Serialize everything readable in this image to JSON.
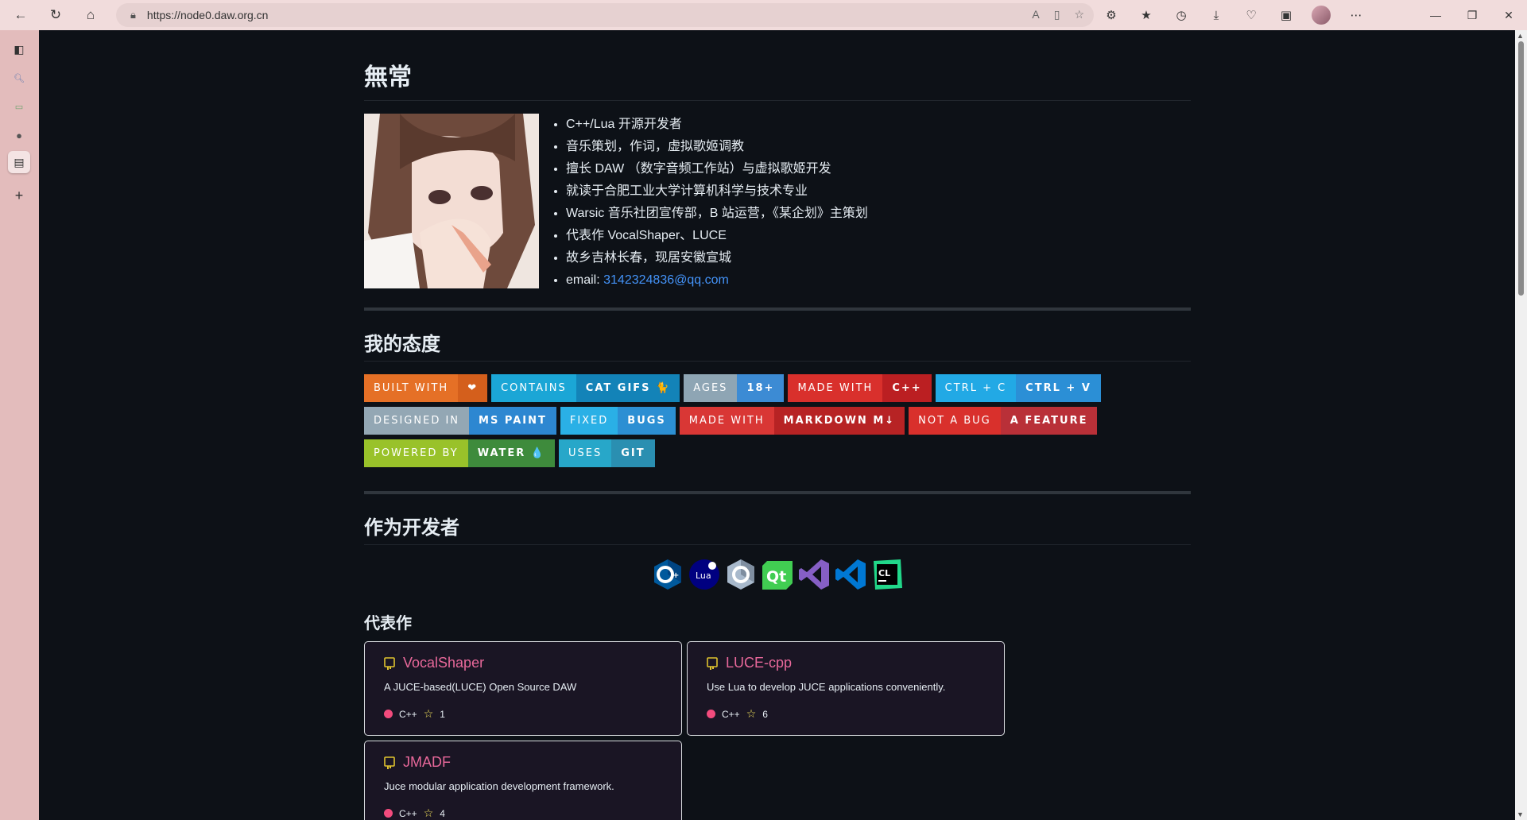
{
  "browser": {
    "url": "https://node0.daw.org.cn"
  },
  "page": {
    "name": "無常",
    "intro_items": [
      "C++/Lua 开源开发者",
      "音乐策划，作词，虚拟歌姬调教",
      "擅长 DAW （数字音频工作站）与虚拟歌姬开发",
      "就读于合肥工业大学计算机科学与技术专业",
      "Warsic 音乐社团宣传部，B 站运营，《某企划》主策划",
      "代表作 VocalShaper、LUCE",
      "故乡吉林长春，现居安徽宣城"
    ],
    "email_label": "email: ",
    "email": "3142324836@qq.com",
    "attitude_heading": "我的态度",
    "badges": [
      {
        "left": "BUILT WITH",
        "right": "❤",
        "lc": "#e57026",
        "rc": "#d45f1c"
      },
      {
        "left": "CONTAINS",
        "right": "CAT GIFS 🐈",
        "lc": "#1ba6d6",
        "rc": "#1383b8"
      },
      {
        "left": "AGES",
        "right": "18+",
        "lc": "#8ea5b4",
        "rc": "#3c8bd4"
      },
      {
        "left": "MADE WITH",
        "right": "C++",
        "lc": "#d9302c",
        "rc": "#bb1f22"
      },
      {
        "left": "CTRL + C",
        "right": "CTRL + V",
        "lc": "#22a9e5",
        "rc": "#2b8fd6"
      },
      {
        "left": "DESIGNED IN",
        "right": "MS PAINT",
        "lc": "#93a7b4",
        "rc": "#2d87d1"
      },
      {
        "left": "FIXED",
        "right": "BUGS",
        "lc": "#2ab0e6",
        "rc": "#2c8fd3"
      },
      {
        "left": "MADE WITH",
        "right": "MARKDOWN M↓",
        "lc": "#d93735",
        "rc": "#b72324"
      },
      {
        "left": "NOT A BUG",
        "right": "A FEATURE",
        "lc": "#d9302c",
        "rc": "#b93038"
      },
      {
        "left": "POWERED BY",
        "right": "WATER 💧",
        "lc": "#99c22a",
        "rc": "#3e8b3c"
      },
      {
        "left": "USES",
        "right": "GIT",
        "lc": "#27a7c9",
        "rc": "#2a8fb1"
      }
    ],
    "dev_heading": "作为开发者",
    "dev_icons": [
      "cplusplus-icon",
      "lua-icon",
      "c-icon",
      "qt-icon",
      "visual-studio-icon",
      "vscode-icon",
      "clion-icon"
    ],
    "works_heading": "代表作",
    "repos": [
      {
        "name": "VocalShaper",
        "desc": "A JUCE-based(LUCE) Open Source DAW",
        "lang": "C++",
        "stars": "1"
      },
      {
        "name": "LUCE-cpp",
        "desc": "Use Lua to develop JUCE applications conveniently.",
        "lang": "C++",
        "stars": "6"
      },
      {
        "name": "JMADF",
        "desc": "Juce modular application development framework.",
        "lang": "C++",
        "stars": "4"
      }
    ]
  }
}
